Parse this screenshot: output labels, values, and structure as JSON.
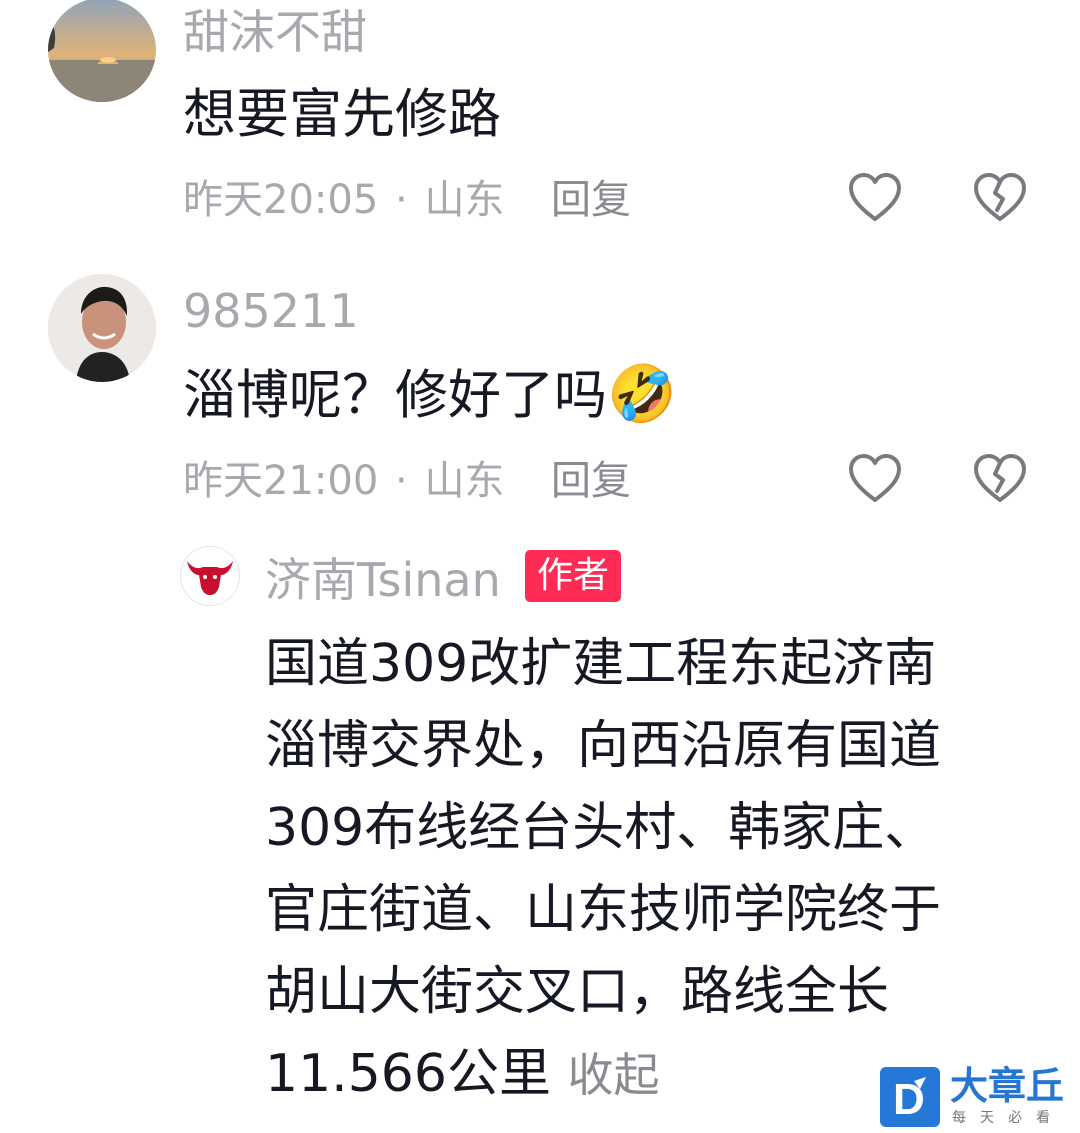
{
  "comments": [
    {
      "username": "甜沫不甜",
      "text": "想要富先修路",
      "time": "昨天20:05",
      "separator": "·",
      "location": "山东",
      "reply_label": "回复",
      "avatar": "sunset-avatar"
    },
    {
      "username": "985211",
      "text": "淄博呢？修好了吗",
      "emoji": "🤣",
      "time": "昨天21:00",
      "separator": "·",
      "location": "山东",
      "reply_label": "回复",
      "avatar": "man-portrait-avatar"
    }
  ],
  "author_reply": {
    "username": "济南Tsinan",
    "badge": "作者",
    "lines": [
      "国道309改扩建工程东起济南",
      "淄博交界处，向西沿原有国道",
      "309布线经台头村、韩家庄、",
      "官庄街道、山东技师学院终于",
      "胡山大街交叉口，路线全长",
      "11.566公里"
    ],
    "collapse_label": "收起",
    "avatar": "bull-logo-avatar"
  },
  "watermark": {
    "title": "大章丘",
    "subtitle": "每天必看",
    "logo_letter": "D"
  },
  "colors": {
    "accent": "#fe2c55",
    "secondary_text": "#a8a9ae",
    "primary_text": "#161823",
    "watermark_blue": "#2678d6"
  }
}
